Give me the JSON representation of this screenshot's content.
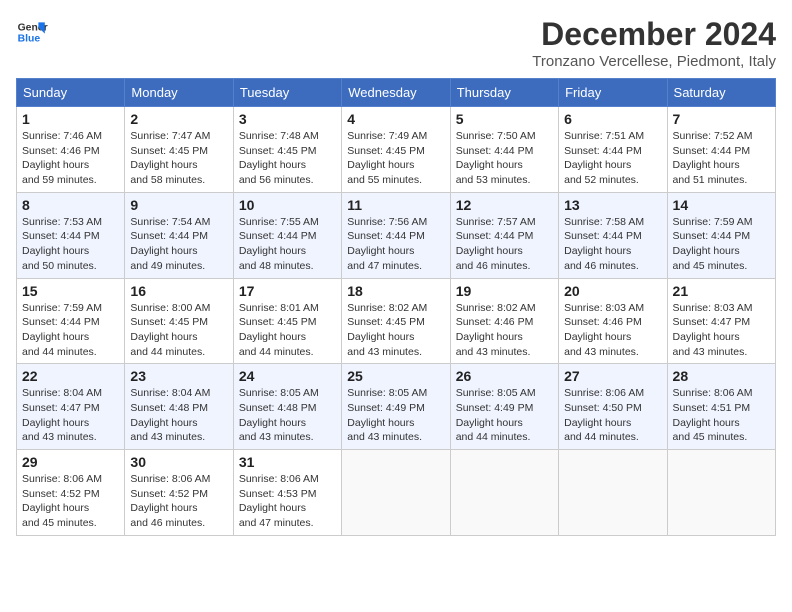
{
  "header": {
    "logo_line1": "General",
    "logo_line2": "Blue",
    "month_year": "December 2024",
    "location": "Tronzano Vercellese, Piedmont, Italy"
  },
  "days_of_week": [
    "Sunday",
    "Monday",
    "Tuesday",
    "Wednesday",
    "Thursday",
    "Friday",
    "Saturday"
  ],
  "weeks": [
    [
      {
        "day": "1",
        "sunrise": "7:46 AM",
        "sunset": "4:46 PM",
        "daylight": "8 hours and 59 minutes."
      },
      {
        "day": "2",
        "sunrise": "7:47 AM",
        "sunset": "4:45 PM",
        "daylight": "8 hours and 58 minutes."
      },
      {
        "day": "3",
        "sunrise": "7:48 AM",
        "sunset": "4:45 PM",
        "daylight": "8 hours and 56 minutes."
      },
      {
        "day": "4",
        "sunrise": "7:49 AM",
        "sunset": "4:45 PM",
        "daylight": "8 hours and 55 minutes."
      },
      {
        "day": "5",
        "sunrise": "7:50 AM",
        "sunset": "4:44 PM",
        "daylight": "8 hours and 53 minutes."
      },
      {
        "day": "6",
        "sunrise": "7:51 AM",
        "sunset": "4:44 PM",
        "daylight": "8 hours and 52 minutes."
      },
      {
        "day": "7",
        "sunrise": "7:52 AM",
        "sunset": "4:44 PM",
        "daylight": "8 hours and 51 minutes."
      }
    ],
    [
      {
        "day": "8",
        "sunrise": "7:53 AM",
        "sunset": "4:44 PM",
        "daylight": "8 hours and 50 minutes."
      },
      {
        "day": "9",
        "sunrise": "7:54 AM",
        "sunset": "4:44 PM",
        "daylight": "8 hours and 49 minutes."
      },
      {
        "day": "10",
        "sunrise": "7:55 AM",
        "sunset": "4:44 PM",
        "daylight": "8 hours and 48 minutes."
      },
      {
        "day": "11",
        "sunrise": "7:56 AM",
        "sunset": "4:44 PM",
        "daylight": "8 hours and 47 minutes."
      },
      {
        "day": "12",
        "sunrise": "7:57 AM",
        "sunset": "4:44 PM",
        "daylight": "8 hours and 46 minutes."
      },
      {
        "day": "13",
        "sunrise": "7:58 AM",
        "sunset": "4:44 PM",
        "daylight": "8 hours and 46 minutes."
      },
      {
        "day": "14",
        "sunrise": "7:59 AM",
        "sunset": "4:44 PM",
        "daylight": "8 hours and 45 minutes."
      }
    ],
    [
      {
        "day": "15",
        "sunrise": "7:59 AM",
        "sunset": "4:44 PM",
        "daylight": "8 hours and 44 minutes."
      },
      {
        "day": "16",
        "sunrise": "8:00 AM",
        "sunset": "4:45 PM",
        "daylight": "8 hours and 44 minutes."
      },
      {
        "day": "17",
        "sunrise": "8:01 AM",
        "sunset": "4:45 PM",
        "daylight": "8 hours and 44 minutes."
      },
      {
        "day": "18",
        "sunrise": "8:02 AM",
        "sunset": "4:45 PM",
        "daylight": "8 hours and 43 minutes."
      },
      {
        "day": "19",
        "sunrise": "8:02 AM",
        "sunset": "4:46 PM",
        "daylight": "8 hours and 43 minutes."
      },
      {
        "day": "20",
        "sunrise": "8:03 AM",
        "sunset": "4:46 PM",
        "daylight": "8 hours and 43 minutes."
      },
      {
        "day": "21",
        "sunrise": "8:03 AM",
        "sunset": "4:47 PM",
        "daylight": "8 hours and 43 minutes."
      }
    ],
    [
      {
        "day": "22",
        "sunrise": "8:04 AM",
        "sunset": "4:47 PM",
        "daylight": "8 hours and 43 minutes."
      },
      {
        "day": "23",
        "sunrise": "8:04 AM",
        "sunset": "4:48 PM",
        "daylight": "8 hours and 43 minutes."
      },
      {
        "day": "24",
        "sunrise": "8:05 AM",
        "sunset": "4:48 PM",
        "daylight": "8 hours and 43 minutes."
      },
      {
        "day": "25",
        "sunrise": "8:05 AM",
        "sunset": "4:49 PM",
        "daylight": "8 hours and 43 minutes."
      },
      {
        "day": "26",
        "sunrise": "8:05 AM",
        "sunset": "4:49 PM",
        "daylight": "8 hours and 44 minutes."
      },
      {
        "day": "27",
        "sunrise": "8:06 AM",
        "sunset": "4:50 PM",
        "daylight": "8 hours and 44 minutes."
      },
      {
        "day": "28",
        "sunrise": "8:06 AM",
        "sunset": "4:51 PM",
        "daylight": "8 hours and 45 minutes."
      }
    ],
    [
      {
        "day": "29",
        "sunrise": "8:06 AM",
        "sunset": "4:52 PM",
        "daylight": "8 hours and 45 minutes."
      },
      {
        "day": "30",
        "sunrise": "8:06 AM",
        "sunset": "4:52 PM",
        "daylight": "8 hours and 46 minutes."
      },
      {
        "day": "31",
        "sunrise": "8:06 AM",
        "sunset": "4:53 PM",
        "daylight": "8 hours and 47 minutes."
      },
      null,
      null,
      null,
      null
    ]
  ]
}
